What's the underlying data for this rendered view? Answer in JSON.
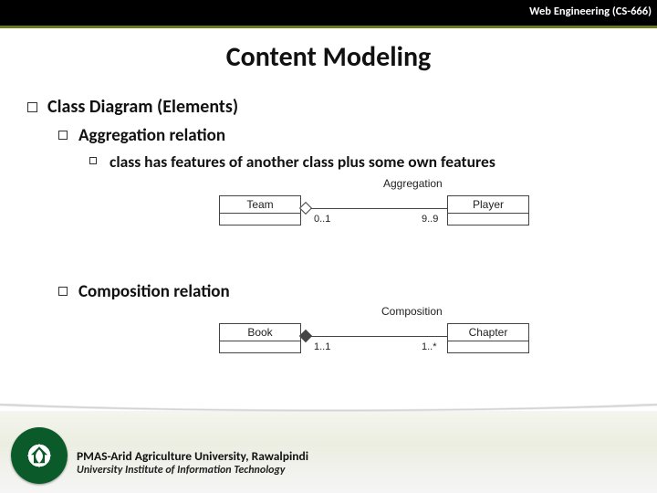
{
  "header": {
    "course": "Web Engineering (CS-666)"
  },
  "title": "Content Modeling",
  "bullets": {
    "l1": "Class Diagram (Elements)",
    "l2a": "Aggregation relation",
    "l3a": "class has features of another class plus some own features",
    "l2b": "Composition relation"
  },
  "diagram_aggregation": {
    "label": "Aggregation",
    "left_box": "Team",
    "right_box": "Player",
    "mult_left": "0..1",
    "mult_right": "9..9"
  },
  "diagram_composition": {
    "label": "Composition",
    "left_box": "Book",
    "right_box": "Chapter",
    "mult_left": "1..1",
    "mult_right": "1..*"
  },
  "footer": {
    "line1": "PMAS-Arid Agriculture University, Rawalpindi",
    "line2": "University Institute of Information Technology"
  }
}
